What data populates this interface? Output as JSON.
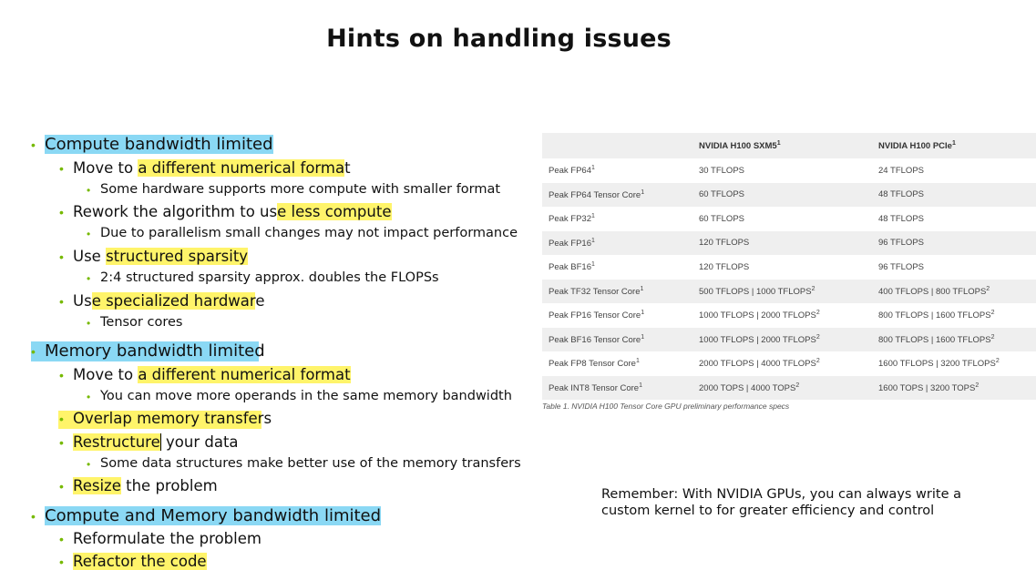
{
  "title": "Hints on handling issues",
  "bullets": {
    "b1": "Compute bandwidth limited",
    "b1_1_pre": "Move to ",
    "b1_1_hl": "a different numerical forma",
    "b1_1_post": "t",
    "b1_1_1": "Some hardware supports more compute with smaller format",
    "b1_2_pre": "Rework the algorithm to us",
    "b1_2_hl": "e less compute",
    "b1_2_1": "Due to parallelism small changes may not impact performance",
    "b1_3_pre": "Use ",
    "b1_3_hl": "structured sparsity",
    "b1_3_1": "2:4 structured sparsity approx. doubles the FLOPSs",
    "b1_4_pre": "Us",
    "b1_4_hl": "e specialized hardwar",
    "b1_4_post": "e",
    "b1_4_1": "Tensor cores",
    "b2": "Memory bandwidth limited",
    "b2_1_pre": "Move to ",
    "b2_1_hl": "a different numerical format",
    "b2_1_1": "You can move more operands in the same memory bandwidth",
    "b2_2_hl": "Overlap memory transfers",
    "b2_3_hl": "Restructure",
    "b2_3_post": " your data",
    "b2_3_1": "Some data structures make better use of the memory transfers",
    "b2_4_hl": "Resize",
    "b2_4_post": " the problem",
    "b3": "Compute and Memory bandwidth limited",
    "b3_1": "Reformulate the problem",
    "b3_2_hl": "Refactor the code"
  },
  "table": {
    "headers": [
      "",
      "NVIDIA H100 SXM5",
      "NVIDIA H100 PCIe"
    ],
    "header_sup": "1",
    "rows": [
      {
        "label": "Peak FP64",
        "sxm": "30 TFLOPS",
        "pcie": "24 TFLOPS"
      },
      {
        "label": "Peak FP64 Tensor Core",
        "sxm": "60 TFLOPS",
        "pcie": "48 TFLOPS"
      },
      {
        "label": "Peak FP32",
        "sxm": "60 TFLOPS",
        "pcie": "48 TFLOPS"
      },
      {
        "label": "Peak FP16",
        "sxm": "120 TFLOPS",
        "pcie": "96 TFLOPS"
      },
      {
        "label": "Peak BF16",
        "sxm": "120 TFLOPS",
        "pcie": "96 TFLOPS"
      },
      {
        "label": "Peak TF32 Tensor Core",
        "sxm": "500 TFLOPS | 1000 TFLOPS",
        "pcie": "400 TFLOPS | 800 TFLOPS"
      },
      {
        "label": "Peak FP16 Tensor Core",
        "sxm": "1000 TFLOPS | 2000 TFLOPS",
        "pcie": "800 TFLOPS | 1600 TFLOPS"
      },
      {
        "label": "Peak BF16 Tensor Core",
        "sxm": "1000 TFLOPS | 2000 TFLOPS",
        "pcie": "800 TFLOPS | 1600 TFLOPS"
      },
      {
        "label": "Peak FP8 Tensor Core",
        "sxm": "2000 TFLOPS | 4000 TFLOPS",
        "pcie": "1600 TFLOPS | 3200 TFLOPS"
      },
      {
        "label": "Peak INT8 Tensor Core",
        "sxm": "2000 TOPS | 4000 TOPS",
        "pcie": "1600 TOPS | 3200 TOPS"
      }
    ],
    "sup1": "1",
    "sup2": "2",
    "caption": "Table 1. NVIDIA H100 Tensor Core GPU preliminary performance specs"
  },
  "note": "Remember: With NVIDIA GPUs, you can always write a custom kernel to for greater efficiency and control",
  "colors": {
    "bullet": "#76b900",
    "highlight_blue": "#8ad8f4",
    "highlight_yellow": "#fff46a"
  }
}
